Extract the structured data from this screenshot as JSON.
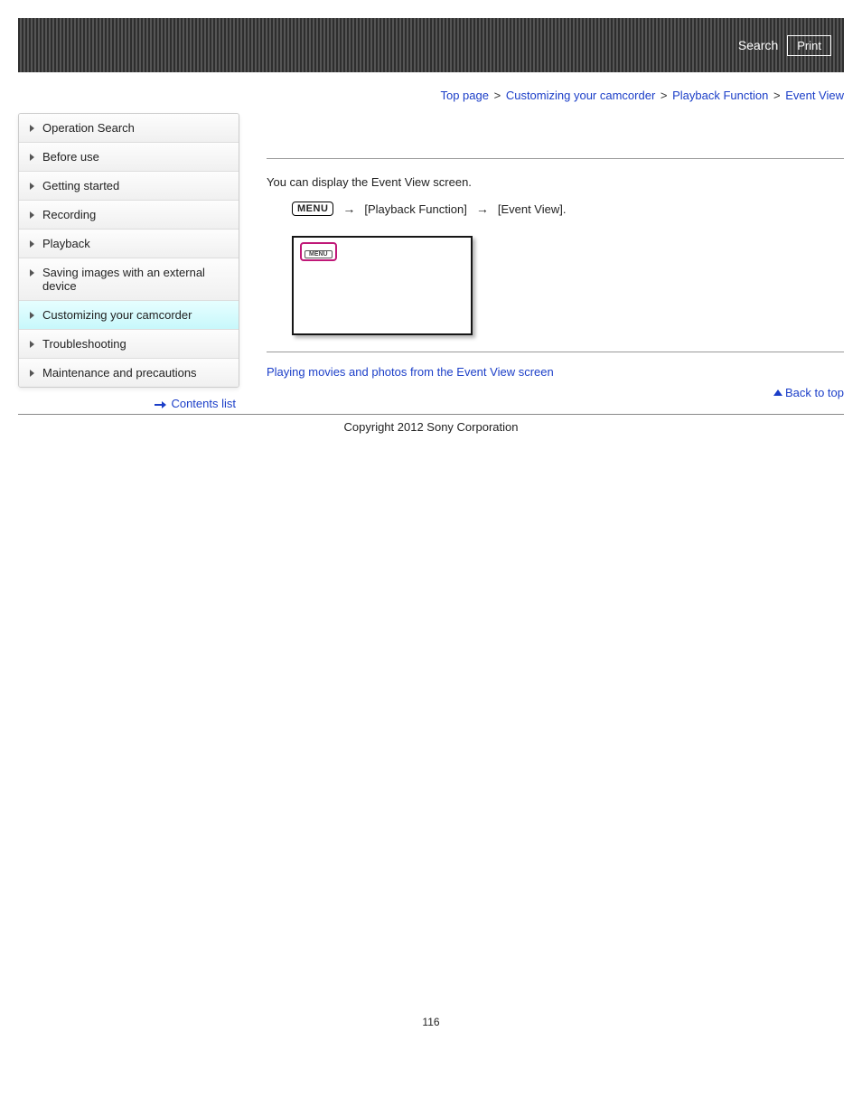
{
  "header": {
    "search_label": "Search",
    "print_label": "Print"
  },
  "breadcrumb": {
    "top": "Top page",
    "cat": "Customizing your camcorder",
    "sub": "Playback Function",
    "current": "Event View"
  },
  "sidebar": {
    "items": [
      {
        "label": "Operation Search",
        "active": false
      },
      {
        "label": "Before use",
        "active": false
      },
      {
        "label": "Getting started",
        "active": false
      },
      {
        "label": "Recording",
        "active": false
      },
      {
        "label": "Playback",
        "active": false
      },
      {
        "label": "Saving images with an external device",
        "active": false
      },
      {
        "label": "Customizing your camcorder",
        "active": true
      },
      {
        "label": "Troubleshooting",
        "active": false
      },
      {
        "label": "Maintenance and precautions",
        "active": false
      }
    ],
    "contents_list_label": "Contents list"
  },
  "main": {
    "instruction": "You can display the Event View screen.",
    "menu_label": "MENU",
    "path_segment1": "[Playback Function]",
    "path_segment2": "[Event View].",
    "thumb_menu_tiny": "MENU",
    "related_link": "Playing movies and photos from the Event View screen",
    "back_to_top": "Back to top"
  },
  "footer": {
    "copyright": "Copyright 2012 Sony Corporation",
    "page_number": "116"
  }
}
